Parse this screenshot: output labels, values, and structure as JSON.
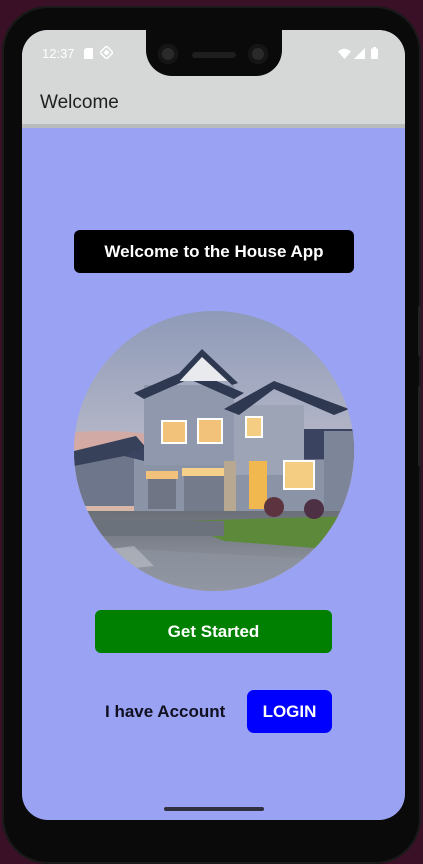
{
  "status_bar": {
    "time": "12:37",
    "icons": [
      "sim-card-icon",
      "settings-diamond-icon",
      "wifi-icon",
      "cell-signal-icon",
      "battery-icon"
    ]
  },
  "app_bar": {
    "title": "Welcome"
  },
  "main": {
    "welcome_label": "Welcome to the House App",
    "hero_image": "house-photo",
    "get_started_label": "Get Started",
    "account_text": "I have Account",
    "login_label": "LOGIN"
  },
  "colors": {
    "screen_background": "#9aa2f3",
    "app_bar_background": "#d6d8d8",
    "welcome_badge": "#000000",
    "get_started_button": "#008000",
    "login_button": "#0000ff"
  }
}
